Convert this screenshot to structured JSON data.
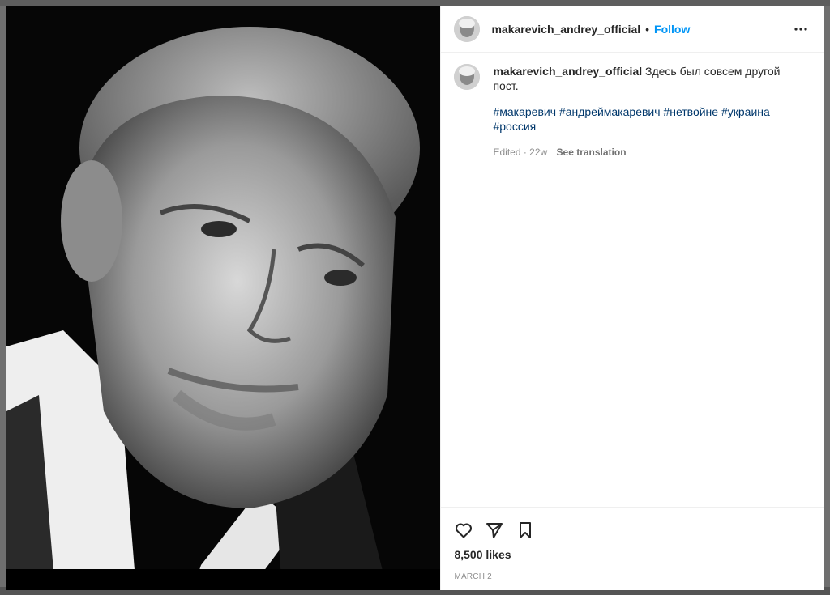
{
  "post": {
    "username": "makarevich_andrey_official",
    "separator": "•",
    "follow_label": "Follow",
    "more_icon": "more-options-icon",
    "caption": "Здесь был совсем другой пост.",
    "hashtags": [
      "#макаревич",
      "#андреймакаревич",
      "#нетвойне",
      "#украина",
      "#россия"
    ],
    "edited": "Edited · 22w",
    "see_translation": "See translation",
    "likes": "8,500 likes",
    "date": "MARCH 2"
  },
  "icons": {
    "like": "heart-icon",
    "share": "send-icon",
    "save": "bookmark-icon"
  },
  "colors": {
    "accent": "#0095f6",
    "hashtag": "#00376b",
    "text": "#262626",
    "muted": "#8e8e8e"
  }
}
